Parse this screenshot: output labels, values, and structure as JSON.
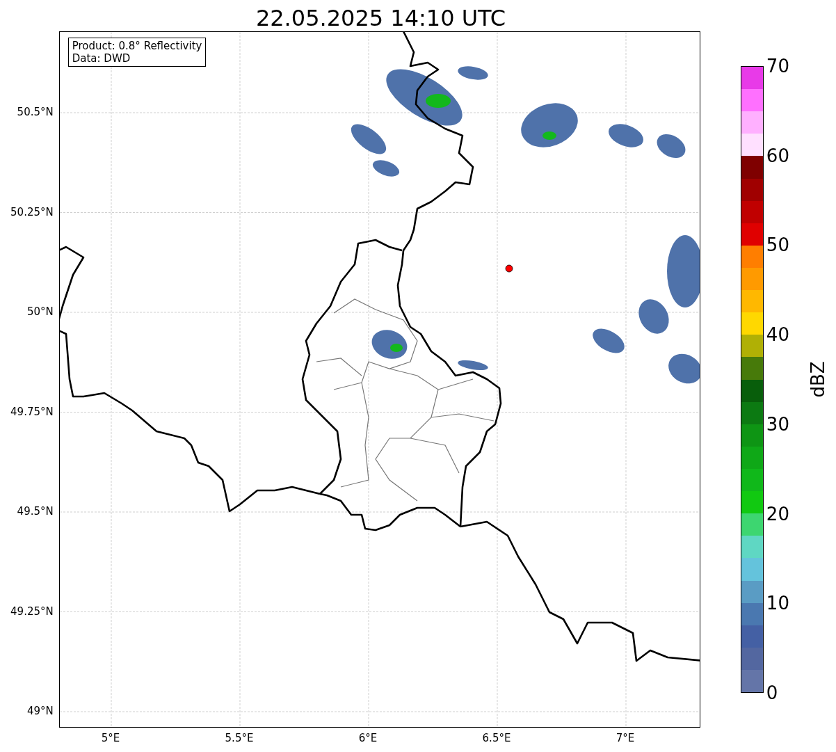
{
  "title": "22.05.2025 14:10 UTC",
  "legend": {
    "lines": [
      "Product: 0.8° Reflectivity",
      "Data: DWD"
    ]
  },
  "y_axis": {
    "ticks": [
      "50.5°N",
      "50.25°N",
      "50°N",
      "49.75°N",
      "49.5°N",
      "49.25°N",
      "49°N"
    ]
  },
  "x_axis": {
    "ticks": [
      "5°E",
      "5.5°E",
      "6°E",
      "6.5°E",
      "7°E"
    ]
  },
  "colorbar": {
    "label": "dBZ",
    "ticks": [
      "70",
      "60",
      "50",
      "40",
      "30",
      "20",
      "10",
      "0"
    ],
    "segments": [
      {
        "color": "#e83ae8"
      },
      {
        "color": "#ff70ff"
      },
      {
        "color": "#ffb0ff"
      },
      {
        "color": "#ffe0ff"
      },
      {
        "color": "#7f0000"
      },
      {
        "color": "#a00000"
      },
      {
        "color": "#c00000"
      },
      {
        "color": "#e00000"
      },
      {
        "color": "#ff7e00"
      },
      {
        "color": "#ff9a00"
      },
      {
        "color": "#ffb800"
      },
      {
        "color": "#ffd800"
      },
      {
        "color": "#b0b005"
      },
      {
        "color": "#477a0a"
      },
      {
        "color": "#085e0b"
      },
      {
        "color": "#0c7a12"
      },
      {
        "color": "#0e9514"
      },
      {
        "color": "#0fa817"
      },
      {
        "color": "#10b81a"
      },
      {
        "color": "#11c911"
      },
      {
        "color": "#3dd670"
      },
      {
        "color": "#5fd7c3"
      },
      {
        "color": "#64c3dc"
      },
      {
        "color": "#5a9cc4"
      },
      {
        "color": "#4a78b0"
      },
      {
        "color": "#4460a4"
      },
      {
        "color": "#5367a0"
      },
      {
        "color": "#6475a8"
      }
    ]
  }
}
